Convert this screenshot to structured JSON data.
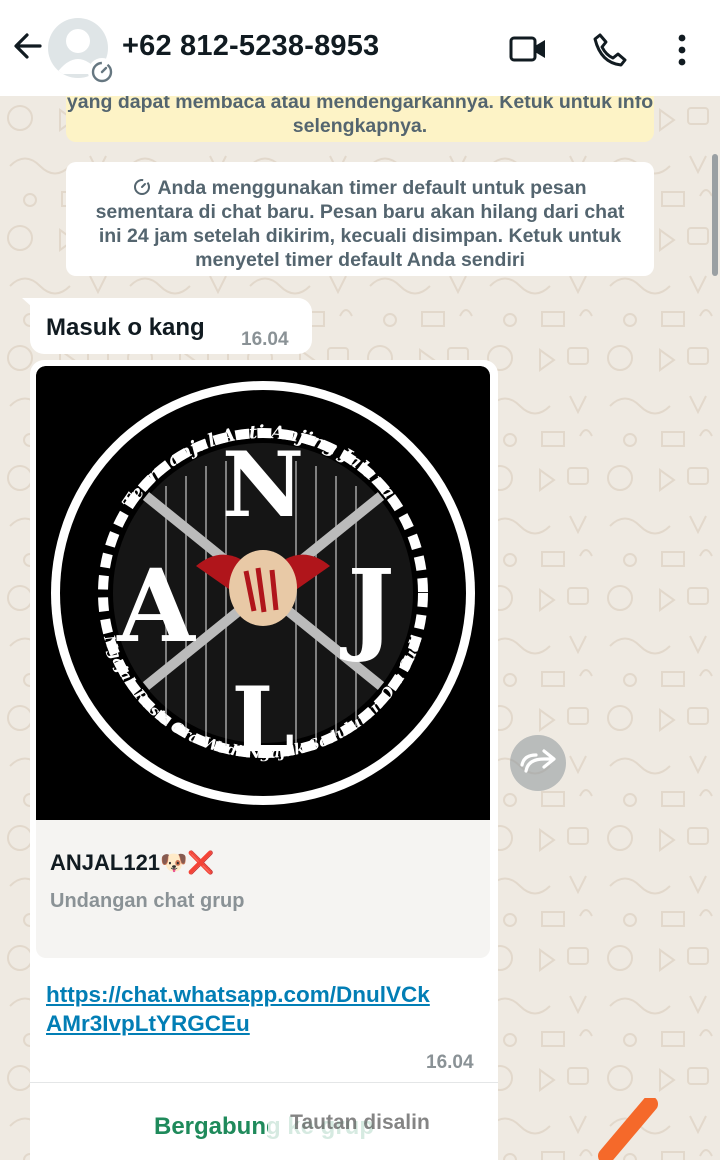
{
  "header": {
    "contact_name": "+62 812-5238-8953",
    "back_icon": "arrow-left-icon",
    "avatar_icon": "default-avatar-icon",
    "timer_badge_icon": "disappearing-timer-icon",
    "video_icon": "video-call-icon",
    "call_icon": "phone-icon",
    "menu_icon": "kebab-menu-icon"
  },
  "notices": {
    "e2e_partial": "yang dapat membaca atau mendengarkannya. Ketuk untuk info selengkapnya.",
    "timer_notice": "Anda menggunakan timer default untuk pesan sementara di chat baru. Pesan baru akan hilang dari chat ini 24 jam setelah dikirim, kecuali disimpan. Ketuk untuk menyetel timer default Anda sendiri"
  },
  "messages": [
    {
      "text": "Masuk o kang",
      "time": "16.04"
    },
    {
      "invite": {
        "group_name": "ANJAL121🐶❌",
        "subtitle": "Undangan chat grup",
        "image": {
          "arc_top": "Team anjal  Anti Anjing Jalanan",
          "arc_bottom": "Ngajak Rasis Ora Wedi Ngajak Seduluran Ora Sudi"
        }
      },
      "link": "https://chat.whatsapp.com/DnulVCkAMr3IvpLtYRGCEu",
      "time": "16.04",
      "join_label": "Bergabung ke grup"
    }
  ],
  "forward_icon": "forward-arrow-icon",
  "toast": "Tautan disalin",
  "colors": {
    "header_bg": "#ffffff",
    "chat_bg": "#efeae2",
    "e2e_notice_bg": "#fdf3c6",
    "link": "#027eb5",
    "join_button": "#1f8a5b",
    "timestamp": "#8a9296"
  }
}
